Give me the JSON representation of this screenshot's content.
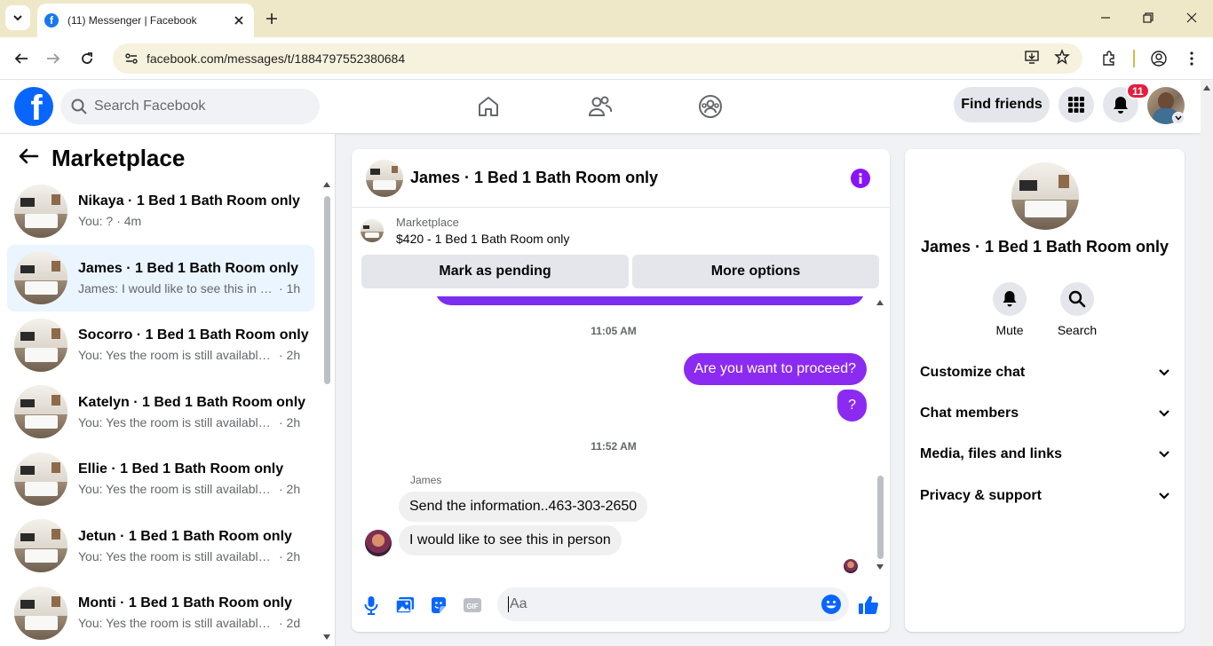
{
  "browser": {
    "tab_title": "(11) Messenger | Facebook",
    "url": "facebook.com/messages/t/1884797552380684"
  },
  "header": {
    "logo_letter": "f",
    "search_placeholder": "Search Facebook",
    "find_friends_label": "Find friends",
    "notification_count": "11"
  },
  "sidebar": {
    "title": "Marketplace",
    "conversations": [
      {
        "name": "Nikaya · 1 Bed 1 Bath Room only",
        "preview": "You: ?",
        "time": " · 4m",
        "active": false
      },
      {
        "name": "James · 1 Bed 1 Bath Room only",
        "preview": "James: I would like to see this in pe...",
        "time": "· 1h",
        "active": true
      },
      {
        "name": "Socorro · 1 Bed 1 Bath Room only",
        "preview": "You: Yes the room is still available f...",
        "time": "· 2h",
        "active": false
      },
      {
        "name": "Katelyn · 1 Bed 1 Bath Room only",
        "preview": "You: Yes the room is still available f...",
        "time": "· 2h",
        "active": false
      },
      {
        "name": "Ellie · 1 Bed 1 Bath Room only",
        "preview": "You: Yes the room is still available f...",
        "time": "· 2h",
        "active": false
      },
      {
        "name": "Jetun · 1 Bed 1 Bath Room only",
        "preview": "You: Yes the room is still available f...",
        "time": "· 2h",
        "active": false
      },
      {
        "name": "Monti · 1 Bed 1 Bath Room only",
        "preview": "You: Yes the room is still available f...",
        "time": "· 2d",
        "active": false
      }
    ]
  },
  "chat": {
    "title": "James · 1 Bed 1 Bath Room only",
    "listing_label": "Marketplace",
    "listing_price": "$420 - 1 Bed 1 Bath Room only",
    "mark_pending_label": "Mark as pending",
    "more_options_label": "More options",
    "messages": {
      "ts1": "11:05 AM",
      "out1": "Are you want to proceed?",
      "out2": "?",
      "ts2": "11:52 AM",
      "sender": "James",
      "in1": "Send the information..463-303-2650",
      "in2": "I would like to see this in person"
    },
    "composer_placeholder": "Aa",
    "composer_icons": [
      "microphone-icon",
      "photo-icon",
      "sticker-icon",
      "gif-icon",
      "emoji-icon",
      "thumbs-up-icon"
    ]
  },
  "info_panel": {
    "name": "James · 1 Bed 1 Bath Room only",
    "mute_label": "Mute",
    "search_label": "Search",
    "sections": [
      "Customize chat",
      "Chat members",
      "Media, files and links",
      "Privacy & support"
    ]
  },
  "colors": {
    "facebook_blue": "#0866ff",
    "messenger_purple": "#8b2bf1",
    "active_row": "#ebf5ff",
    "badge_red": "#e41e3f"
  }
}
